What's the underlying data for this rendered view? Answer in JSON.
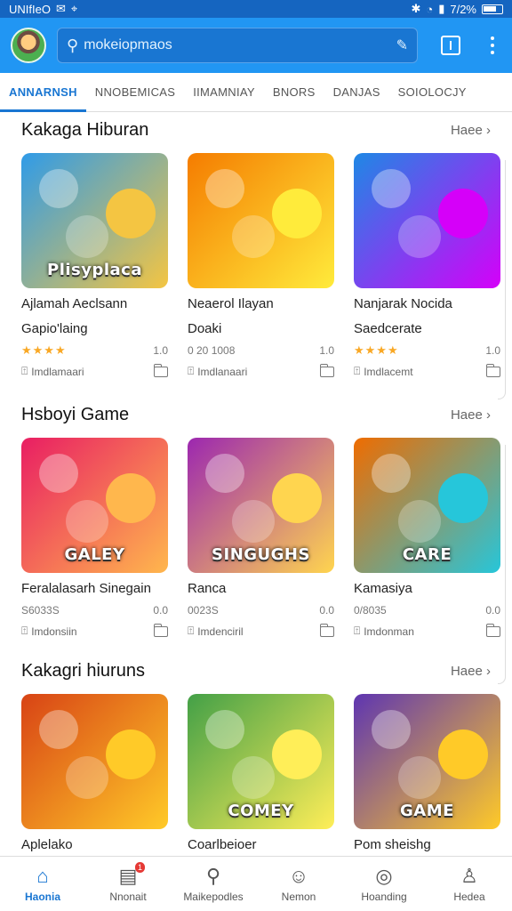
{
  "status_bar": {
    "left_text": "UNIfIeO",
    "right_text": "7/2%"
  },
  "search": {
    "placeholder": "mokeiopmaos"
  },
  "tabs": [
    {
      "label": "ANNARNSH",
      "active": true
    },
    {
      "label": "NNOBEMICAS",
      "active": false
    },
    {
      "label": "IIMAMNIAY",
      "active": false
    },
    {
      "label": "BNORS",
      "active": false
    },
    {
      "label": "DANJAS",
      "active": false
    },
    {
      "label": "SOIOLOCJY",
      "active": false
    }
  ],
  "sections": [
    {
      "title": "Kakaga Hiburan",
      "more": "Haee",
      "cards": [
        {
          "thumb_text": "Plisyplaca",
          "title1": "Ajlamah Aeclsann",
          "title2": "Gapio'laing",
          "meta": "★★★★",
          "meta_right": "1.0",
          "action": "Imdlamaari",
          "bg": "#2f9be8",
          "bg2": "#f4c542"
        },
        {
          "thumb_text": "",
          "title1": "Neaerol Ilayan",
          "title2": "Doaki",
          "meta": "0 20 1008",
          "meta_right": "1.0",
          "action": "Imdlanaari",
          "bg": "#f57c00",
          "bg2": "#ffeb3b"
        },
        {
          "thumb_text": "",
          "title1": "Nanjarak Nocida",
          "title2": "Saedcerate",
          "meta": "★★★★",
          "meta_right": "1.0",
          "action": "Imdlacemt",
          "bg": "#1e88e5",
          "bg2": "#d500f9"
        }
      ]
    },
    {
      "title": "Hsboyi Game",
      "more": "Haee",
      "cards": [
        {
          "thumb_text": "GALEY",
          "title1": "Feralalasarh Sinegain",
          "title2": "",
          "meta": "S6033S",
          "meta_right": "0.0",
          "action": "Imdonsiin",
          "bg": "#e91e63",
          "bg2": "#ffb74d"
        },
        {
          "thumb_text": "SINGUGHS",
          "title1": "Ranca",
          "title2": "",
          "meta": "0023S",
          "meta_right": "0.0",
          "action": "Imdenciril",
          "bg": "#9c27b0",
          "bg2": "#ffd54f"
        },
        {
          "thumb_text": "CARE",
          "title1": "Kamasiya",
          "title2": "",
          "meta": "0/8035",
          "meta_right": "0.0",
          "action": "Imdonman",
          "bg": "#ef6c00",
          "bg2": "#26c6da"
        }
      ]
    },
    {
      "title": "Kakagri hiuruns",
      "more": "Haee",
      "cards": [
        {
          "thumb_text": "",
          "title1": "Aplelako",
          "title2": "",
          "meta": "",
          "meta_right": "",
          "action": "",
          "bg": "#d84315",
          "bg2": "#ffca28"
        },
        {
          "thumb_text": "COMEY",
          "title1": "Coarlbeioer",
          "title2": "",
          "meta": "",
          "meta_right": "",
          "action": "",
          "bg": "#43a047",
          "bg2": "#ffee58"
        },
        {
          "thumb_text": "GAME",
          "title1": "Pom sheishg",
          "title2": "",
          "meta": "",
          "meta_right": "",
          "action": "",
          "bg": "#5e35b1",
          "bg2": "#ffca28"
        }
      ]
    }
  ],
  "bottom_nav": [
    {
      "label": "Haonia",
      "icon": "home-icon",
      "glyph": "⌂",
      "active": true
    },
    {
      "label": "Nnonait",
      "icon": "news-icon",
      "glyph": "▤",
      "badge": "1"
    },
    {
      "label": "Maikepodles",
      "icon": "search-icon",
      "glyph": "⚲"
    },
    {
      "label": "Nemon",
      "icon": "person-icon",
      "glyph": "☺"
    },
    {
      "label": "Hoanding",
      "icon": "award-icon",
      "glyph": "◎"
    },
    {
      "label": "Hedea",
      "icon": "profile-icon",
      "glyph": "♙"
    }
  ],
  "colors": {
    "primary": "#2196f3",
    "primary_dark": "#1565c0",
    "accent": "#1976d2"
  }
}
